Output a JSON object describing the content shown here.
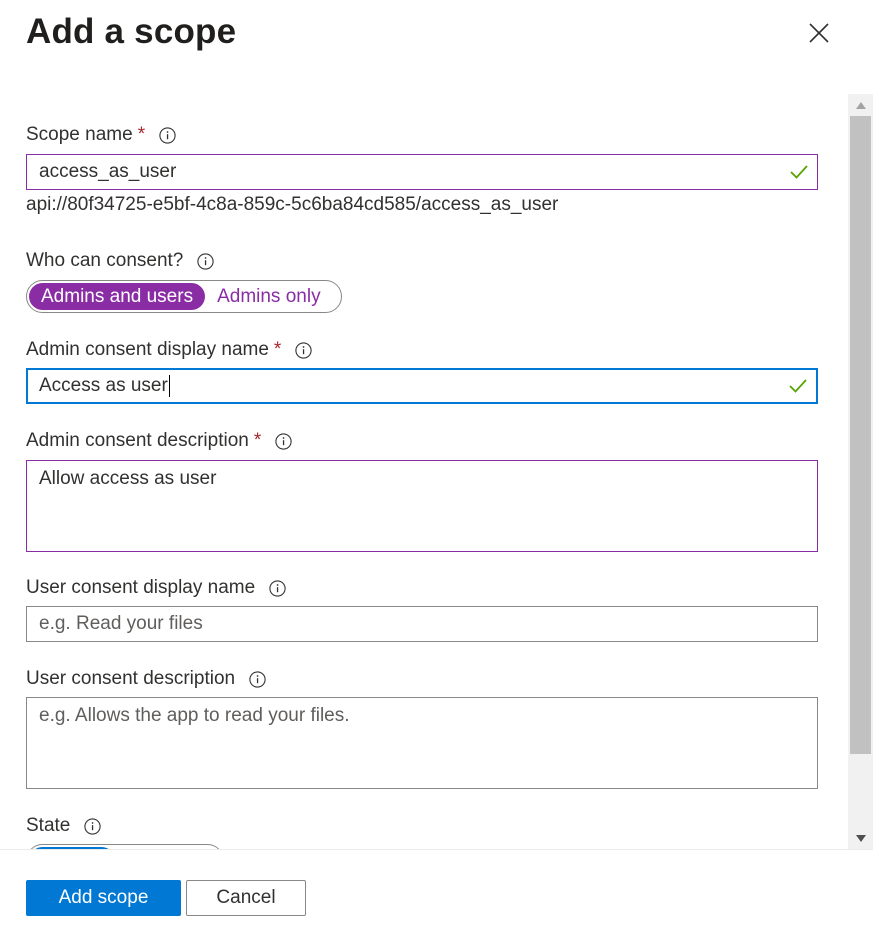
{
  "panel": {
    "title": "Add a scope",
    "close_icon": "close-icon"
  },
  "form": {
    "scope_name": {
      "label": "Scope name",
      "required_mark": "*",
      "value": "access_as_user",
      "valid_icon": "checkmark-icon"
    },
    "scope_uri": "api://80f34725-e5bf-4c8a-859c-5c6ba84cd585/access_as_user",
    "who_can_consent": {
      "label": "Who can consent?",
      "options": [
        "Admins and users",
        "Admins only"
      ],
      "selected": "Admins and users"
    },
    "admin_consent_display_name": {
      "label": "Admin consent display name",
      "required_mark": "*",
      "value": "Access as user",
      "valid_icon": "checkmark-icon"
    },
    "admin_consent_description": {
      "label": "Admin consent description",
      "required_mark": "*",
      "value": "Allow access as user"
    },
    "user_consent_display_name": {
      "label": "User consent display name",
      "placeholder": "e.g. Read your files"
    },
    "user_consent_description": {
      "label": "User consent description",
      "placeholder": "e.g. Allows the app to read your files."
    },
    "state": {
      "label": "State"
    }
  },
  "footer": {
    "add_scope_label": "Add scope",
    "cancel_label": "Cancel"
  },
  "colors": {
    "accent_purple": "#8a2da5",
    "primary_blue": "#0078d4",
    "required_red": "#a4262c",
    "valid_green": "#57a300"
  }
}
